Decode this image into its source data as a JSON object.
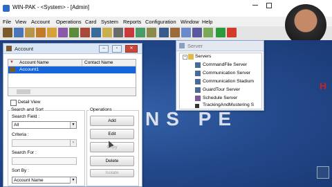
{
  "app": {
    "title": "WIN-PAK - <System> - [Admin]"
  },
  "menu": {
    "items": [
      "File",
      "View",
      "Account",
      "Operations",
      "Card",
      "System",
      "Reports",
      "Configuration",
      "Window",
      "Help"
    ]
  },
  "toolbar": {
    "icons": [
      "account-icon",
      "operator-icon",
      "card-icon",
      "search-icon",
      "user-icon",
      "badge-icon",
      "door-icon",
      "schedule-icon",
      "camera-icon",
      "alarm-icon",
      "report-icon",
      "flag-icon",
      "panel-icon",
      "map-icon",
      "lock-icon",
      "export-icon",
      "import-icon",
      "gear-icon",
      "graph-icon",
      "ok-icon",
      "stop-icon"
    ]
  },
  "workspace": {
    "bg_text": "NS          PE",
    "logo": "H"
  },
  "account_window": {
    "title": "Account",
    "columns": [
      "Account Name",
      "Contact Name"
    ],
    "rows": [
      {
        "name": "Account1",
        "contact": ""
      }
    ],
    "detail_view_label": "Detail View",
    "search_sort": {
      "group_label": "Search and Sort",
      "search_field_label": "Search Field :",
      "search_field_value": "All",
      "criteria_label": "Criteria :",
      "search_for_label": "Search For :",
      "sort_by_label": "Sort By :",
      "sort_by_value": "Account Name"
    },
    "operations": {
      "group_label": "Operations",
      "add": "Add",
      "edit": "Edit",
      "copy": "Copy",
      "delete": "Delete",
      "isolate": "Isolate"
    }
  },
  "server_window": {
    "title": "Server",
    "root": "Servers",
    "items": [
      "CommandFile Server",
      "Communication Server",
      "Communication Stadium",
      "GuardTour Server",
      "Schedule Server",
      "TrackingAndMustering S"
    ]
  },
  "colors": {
    "selection": "#1565d8",
    "workspace": "#23488a",
    "close": "#c9473a",
    "accent_red": "#d21e1e"
  }
}
